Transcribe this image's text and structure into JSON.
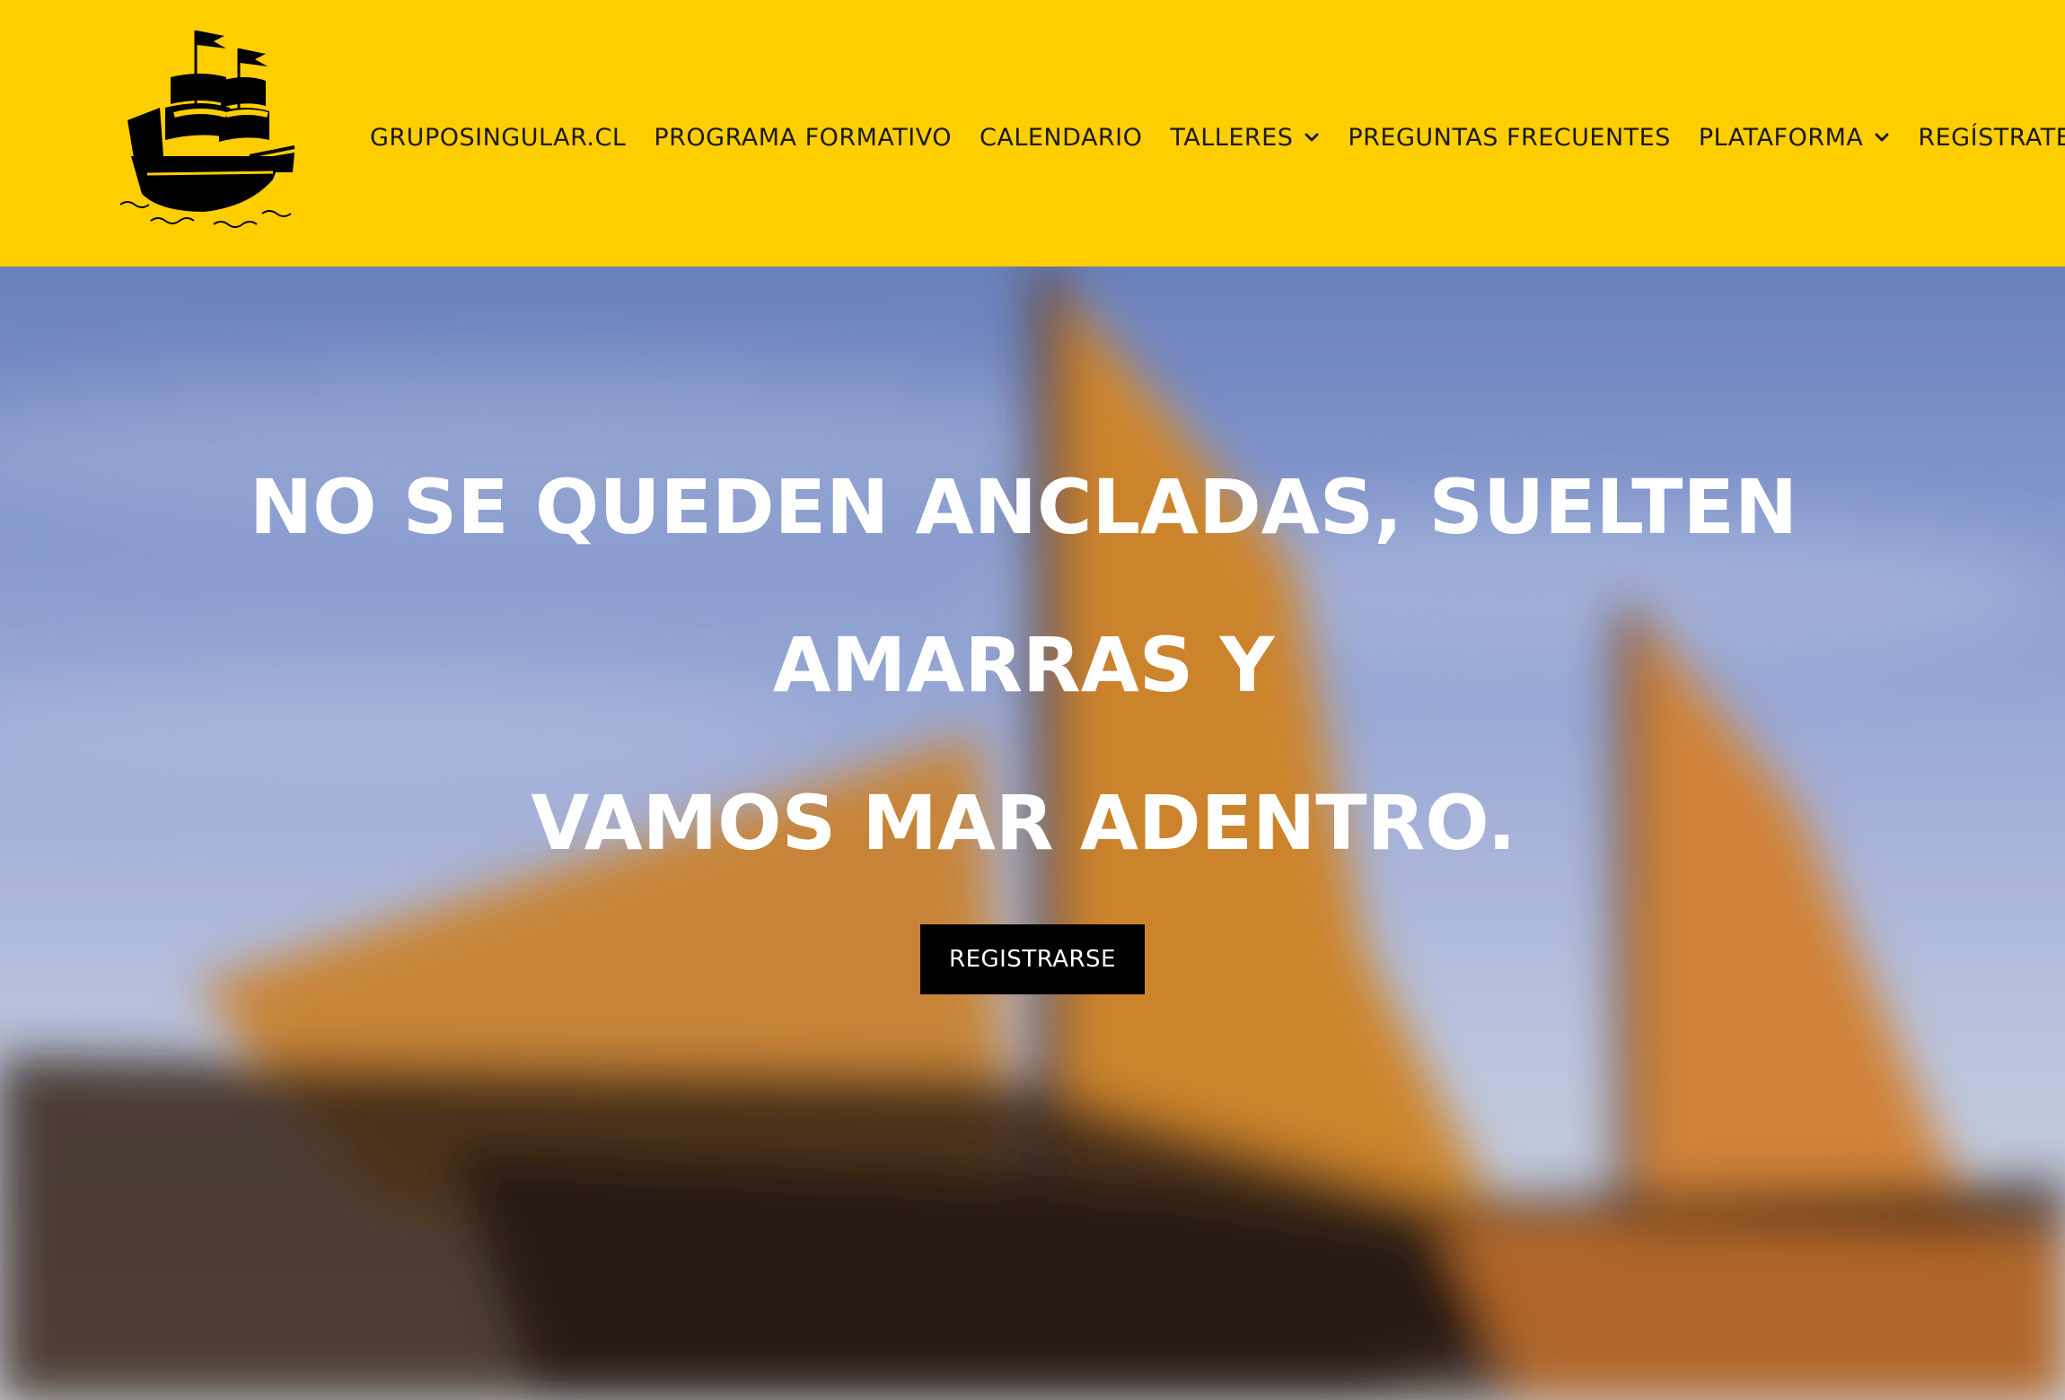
{
  "header": {
    "background_color": "#ffce00",
    "logo_icon": "galleon-ship-icon"
  },
  "nav": {
    "items": [
      {
        "label": "GRUPOSINGULAR.CL",
        "has_dropdown": false
      },
      {
        "label": "PROGRAMA FORMATIVO",
        "has_dropdown": false
      },
      {
        "label": "CALENDARIO",
        "has_dropdown": false
      },
      {
        "label": "TALLERES",
        "has_dropdown": true
      },
      {
        "label": "PREGUNTAS FRECUENTES",
        "has_dropdown": false
      },
      {
        "label": "PLATAFORMA",
        "has_dropdown": true
      },
      {
        "label": "REGÍSTRATE",
        "has_dropdown": false
      }
    ],
    "dropdown_icon": "chevron-down-icon"
  },
  "hero": {
    "title_line1": "NO SE QUEDEN ANCLADAS, SUELTEN AMARRAS Y",
    "title_line2": "VAMOS MAR ADENTRO.",
    "cta_label": "REGISTRARSE",
    "background": "blurred-sailboat-orange-sails-blue-sky",
    "title_color": "#ffffff",
    "cta_color": "#000000"
  }
}
